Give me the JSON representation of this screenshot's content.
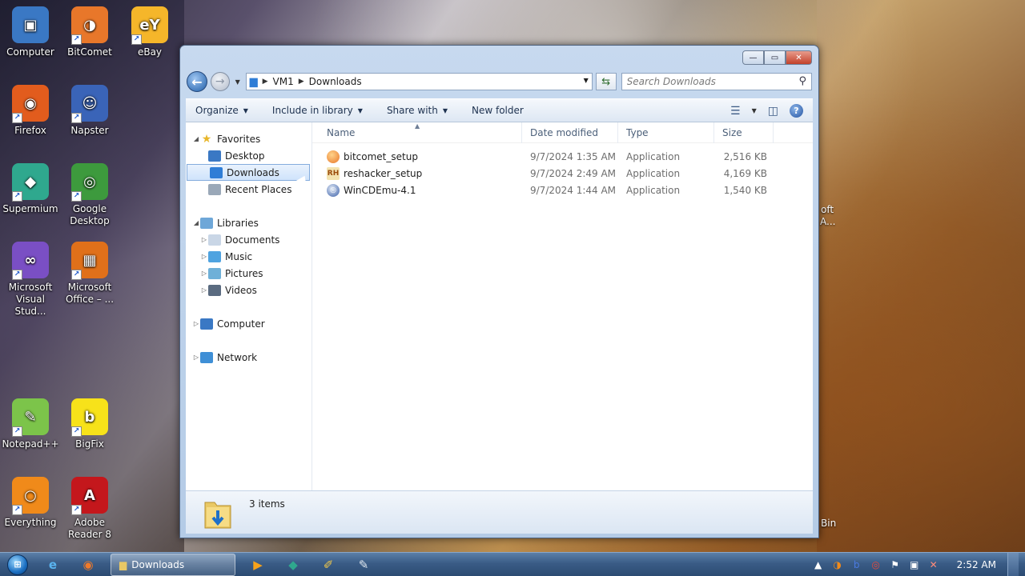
{
  "desktop": {
    "icons": [
      {
        "label": "Computer",
        "glyph": "▣",
        "color": "#3a78c4"
      },
      {
        "label": "BitComet",
        "glyph": "◑",
        "color": "#e8772a"
      },
      {
        "label": "eBay",
        "glyph": "eY",
        "color": "#f5b62a"
      },
      {
        "label": "Firefox",
        "glyph": "◉",
        "color": "#e25c1d"
      },
      {
        "label": "Napster",
        "glyph": "☺",
        "color": "#3a64b8"
      },
      {
        "label": "Supermium",
        "glyph": "◆",
        "color": "#2fa88e"
      },
      {
        "label": "Google Desktop",
        "glyph": "◎",
        "color": "#3d9a3d"
      },
      {
        "label": "Microsoft Visual Stud...",
        "glyph": "∞",
        "color": "#7a4fc4"
      },
      {
        "label": "Microsoft Office – ...",
        "glyph": "▦",
        "color": "#e0701a"
      },
      {
        "label": "Notepad++",
        "glyph": "✎",
        "color": "#7cc44a"
      },
      {
        "label": "BigFix",
        "glyph": "b",
        "color": "#f7e21a"
      },
      {
        "label": "Everything",
        "glyph": "○",
        "color": "#f08a1a"
      },
      {
        "label": "Adobe Reader 8",
        "glyph": "A",
        "color": "#c4171c"
      }
    ],
    "partial_labels": [
      "oft",
      "A...",
      "Bin"
    ]
  },
  "window": {
    "controls": {
      "minimize": "—",
      "maximize": "▭",
      "close": "✕"
    },
    "address": {
      "crumbs": [
        "VM1",
        "Downloads"
      ]
    },
    "search": {
      "placeholder": "Search Downloads"
    },
    "commands": [
      {
        "label": "Organize",
        "has_caret": true
      },
      {
        "label": "Include in library",
        "has_caret": true
      },
      {
        "label": "Share with",
        "has_caret": true
      },
      {
        "label": "New folder",
        "has_caret": false
      }
    ],
    "nav": {
      "favorites": {
        "label": "Favorites",
        "items": [
          "Desktop",
          "Downloads",
          "Recent Places"
        ],
        "selected": "Downloads"
      },
      "libraries": {
        "label": "Libraries",
        "items": [
          "Documents",
          "Music",
          "Pictures",
          "Videos"
        ]
      },
      "computer": "Computer",
      "network": "Network"
    },
    "columns": {
      "name": "Name",
      "date": "Date modified",
      "type": "Type",
      "size": "Size"
    },
    "files": [
      {
        "name": "bitcomet_setup",
        "date": "9/7/2024 1:35 AM",
        "type": "Application",
        "size": "2,516 KB",
        "icon": "bitcomet-icon"
      },
      {
        "name": "reshacker_setup",
        "date": "9/7/2024 2:49 AM",
        "type": "Application",
        "size": "4,169 KB",
        "icon": "reshacker-icon"
      },
      {
        "name": "WinCDEmu-4.1",
        "date": "9/7/2024 1:44 AM",
        "type": "Application",
        "size": "1,540 KB",
        "icon": "wincdemu-icon"
      }
    ],
    "status": {
      "count": "3 items"
    }
  },
  "taskbar": {
    "active_item": "Downloads",
    "clock": "2:52 AM"
  }
}
